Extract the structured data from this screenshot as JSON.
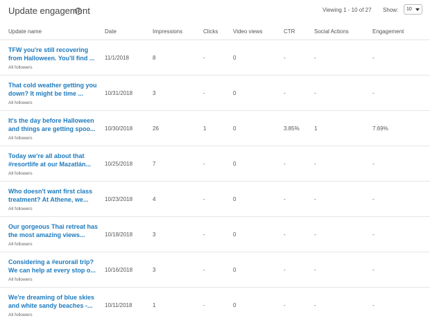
{
  "header": {
    "title": "Update engagement",
    "help_icon": "?",
    "viewing": "Viewing 1 - 10 of 27",
    "show_label": "Show:",
    "show_value": "10"
  },
  "columns": [
    "Update name",
    "Date",
    "Impressions",
    "Clicks",
    "Video views",
    "CTR",
    "Social Actions",
    "Engagement"
  ],
  "rows": [
    {
      "name": "TFW you're still recovering from Halloween. You'll find ...",
      "audience": "All followers",
      "date": "11/1/2018",
      "impressions": "8",
      "clicks": "-",
      "video_views": "0",
      "ctr": "-",
      "social": "-",
      "engagement": "-"
    },
    {
      "name": "That cold weather getting you down? It might be time ...",
      "audience": "All followers",
      "date": "10/31/2018",
      "impressions": "3",
      "clicks": "-",
      "video_views": "0",
      "ctr": "-",
      "social": "-",
      "engagement": "-"
    },
    {
      "name": "It's the day before Halloween and things are getting spoo...",
      "audience": "All followers",
      "date": "10/30/2018",
      "impressions": "26",
      "clicks": "1",
      "video_views": "0",
      "ctr": "3.85%",
      "social": "1",
      "engagement": "7.69%"
    },
    {
      "name": "Today we're all about that #resortlife at our Mazatlán...",
      "audience": "All followers",
      "date": "10/25/2018",
      "impressions": "7",
      "clicks": "-",
      "video_views": "0",
      "ctr": "-",
      "social": "-",
      "engagement": "-"
    },
    {
      "name": "Who doesn't want first class treatment? At Athene, we...",
      "audience": "All followers",
      "date": "10/23/2018",
      "impressions": "4",
      "clicks": "-",
      "video_views": "0",
      "ctr": "-",
      "social": "-",
      "engagement": "-"
    },
    {
      "name": "Our gorgeous Thai retreat has the most amazing views...",
      "audience": "All followers",
      "date": "10/18/2018",
      "impressions": "3",
      "clicks": "-",
      "video_views": "0",
      "ctr": "-",
      "social": "-",
      "engagement": "-"
    },
    {
      "name": "Considering a #eurorail trip? We can help at every stop o...",
      "audience": "All followers",
      "date": "10/16/2018",
      "impressions": "3",
      "clicks": "-",
      "video_views": "0",
      "ctr": "-",
      "social": "-",
      "engagement": "-"
    },
    {
      "name": "We're dreaming of blue skies and white sandy beaches -...",
      "audience": "All followers",
      "date": "10/11/2018",
      "impressions": "1",
      "clicks": "-",
      "video_views": "0",
      "ctr": "-",
      "social": "-",
      "engagement": "-"
    }
  ]
}
